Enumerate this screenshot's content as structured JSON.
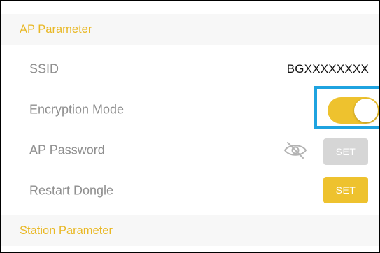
{
  "ap_section": {
    "title": "AP Parameter",
    "rows": {
      "ssid": {
        "label": "SSID",
        "value": "BGXXXXXXXX"
      },
      "encryption": {
        "label": "Encryption Mode",
        "toggle_on": true
      },
      "password": {
        "label": "AP Password",
        "button": "SET",
        "icon": "eye-slash-icon"
      },
      "restart": {
        "label": "Restart Dongle",
        "button": "SET"
      }
    }
  },
  "station_section": {
    "title": "Station Parameter"
  },
  "colors": {
    "accent": "#eec22e",
    "header_text": "#e9b825",
    "highlight": "#1fa3e0",
    "disabled_button": "#d6d6d6"
  }
}
